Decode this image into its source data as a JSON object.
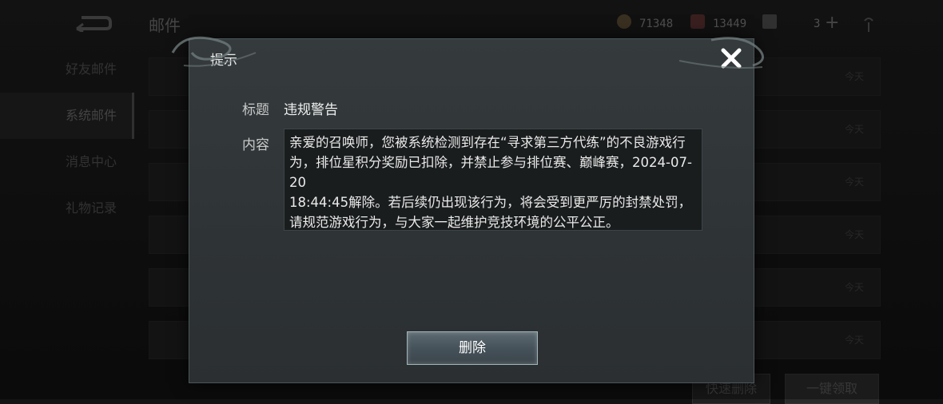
{
  "header": {
    "title": "邮件",
    "currencies": [
      {
        "icon": "coin-icon",
        "value": "71348"
      },
      {
        "icon": "gem-icon",
        "value": "13449"
      },
      {
        "icon": "ticket-icon",
        "value": "3"
      }
    ]
  },
  "sidebar": {
    "items": [
      {
        "label": "好友邮件"
      },
      {
        "label": "系统邮件",
        "active": true
      },
      {
        "label": "消息中心"
      },
      {
        "label": "礼物记录"
      }
    ]
  },
  "mail_list": {
    "days": [
      "今天",
      "今天",
      "今天",
      "今天",
      "今天",
      "今天"
    ]
  },
  "footer": {
    "quick_delete": "快速删除",
    "claim_all": "一键领取"
  },
  "dialog": {
    "title": "提示",
    "subject_label": "标题",
    "subject_value": "违规警告",
    "content_label": "内容",
    "content_text": "亲爱的召唤师，您被系统检测到存在“寻求第三方代练”的不良游戏行为，排位星积分奖励已扣除，并禁止参与排位赛、巅峰赛，2024-07-20\n18:44:45解除。若后续仍出现该行为，将会受到更严厉的封禁处罚，请规范游戏行为，与大家一起维护竞技环境的公平公正。",
    "delete_label": "删除"
  }
}
